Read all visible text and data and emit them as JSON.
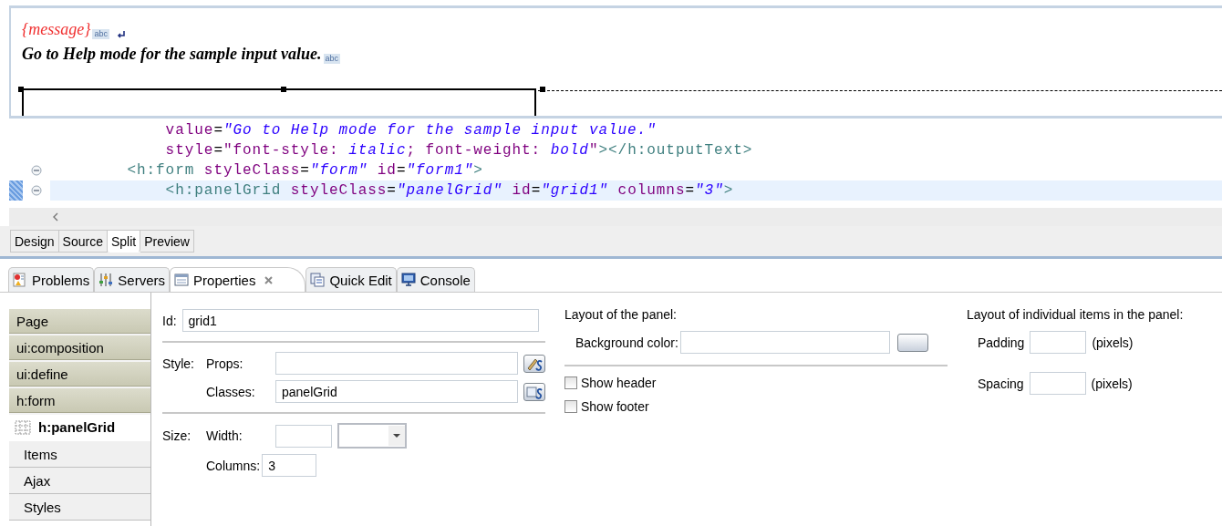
{
  "design_view": {
    "message_text": "{message}",
    "message_marker": "abc",
    "help_text": "Go to Help mode for the sample input value.",
    "help_marker": "abc"
  },
  "source_lines": [
    {
      "fold": false,
      "current": false,
      "tokens": [
        {
          "kind": "attr",
          "text": "            value"
        },
        {
          "kind": "eq",
          "text": "="
        },
        {
          "kind": "value",
          "text": "\"Go to Help mode for the sample input value.\""
        }
      ]
    },
    {
      "fold": false,
      "current": false,
      "tokens": [
        {
          "kind": "attr",
          "text": "            style"
        },
        {
          "kind": "eq",
          "text": "="
        },
        {
          "kind": "plain",
          "text": "\"font-style: "
        },
        {
          "kind": "value",
          "text": "italic"
        },
        {
          "kind": "plain",
          "text": "; font-weight: "
        },
        {
          "kind": "value",
          "text": "bold"
        },
        {
          "kind": "plain",
          "text": "\""
        },
        {
          "kind": "tag",
          "text": "></h:outputText>"
        }
      ]
    },
    {
      "fold": true,
      "current": false,
      "tokens": [
        {
          "kind": "tag",
          "text": "        <h:form"
        },
        {
          "kind": "attr",
          "text": " styleClass"
        },
        {
          "kind": "eq",
          "text": "="
        },
        {
          "kind": "value",
          "text": "\"form\""
        },
        {
          "kind": "attr",
          "text": " id"
        },
        {
          "kind": "eq",
          "text": "="
        },
        {
          "kind": "value",
          "text": "\"form1\""
        },
        {
          "kind": "tag",
          "text": ">"
        }
      ]
    },
    {
      "fold": true,
      "current": true,
      "tokens": [
        {
          "kind": "tag",
          "text": "            <h:panelGrid"
        },
        {
          "kind": "attr",
          "text": " styleClass"
        },
        {
          "kind": "eq",
          "text": "="
        },
        {
          "kind": "value",
          "text": "\"panelGrid\""
        },
        {
          "kind": "attr",
          "text": " id"
        },
        {
          "kind": "eq",
          "text": "="
        },
        {
          "kind": "value",
          "text": "\"grid1\""
        },
        {
          "kind": "attr",
          "text": " columns"
        },
        {
          "kind": "eq",
          "text": "="
        },
        {
          "kind": "value",
          "text": "\"3\""
        },
        {
          "kind": "tag",
          "text": ">"
        }
      ]
    }
  ],
  "editor_tabs": [
    {
      "label": "Design",
      "selected": false
    },
    {
      "label": "Source",
      "selected": false
    },
    {
      "label": "Split",
      "selected": true
    },
    {
      "label": "Preview",
      "selected": false
    }
  ],
  "view_tabs": [
    {
      "label": "Problems",
      "kind": "problems",
      "selected": false,
      "closable": false
    },
    {
      "label": "Servers",
      "kind": "servers",
      "selected": false,
      "closable": false
    },
    {
      "label": "Properties",
      "kind": "properties",
      "selected": true,
      "closable": true
    },
    {
      "label": "Quick Edit",
      "kind": "quickedit",
      "selected": false,
      "closable": false
    },
    {
      "label": "Console",
      "kind": "console",
      "selected": false,
      "closable": false
    }
  ],
  "properties": {
    "sections": [
      {
        "label": "Page",
        "kind": "ancestor"
      },
      {
        "label": "ui:composition",
        "kind": "ancestor"
      },
      {
        "label": "ui:define",
        "kind": "ancestor"
      },
      {
        "label": "h:form",
        "kind": "ancestor"
      },
      {
        "label": "h:panelGrid",
        "kind": "current"
      },
      {
        "label": "Items",
        "kind": "category"
      },
      {
        "label": "Ajax",
        "kind": "category"
      },
      {
        "label": "Styles",
        "kind": "category"
      }
    ],
    "id_label": "Id:",
    "id_value": "grid1",
    "style_label": "Style:",
    "props_label": "Props:",
    "classes_label": "Classes:",
    "classes_value": "panelGrid",
    "size_label": "Size:",
    "width_label": "Width:",
    "columns_label": "Columns:",
    "columns_value": "3",
    "panel_layout_title": "Layout of the panel:",
    "background_label": "Background color:",
    "checkboxes": [
      {
        "label": "Show header",
        "checked": false
      },
      {
        "label": "Show footer",
        "checked": false
      }
    ],
    "items_layout_title": "Layout of individual items in the panel:",
    "padding_label": "Padding",
    "padding_unit": "(pixels)",
    "spacing_label": "Spacing",
    "spacing_unit": "(pixels)"
  }
}
